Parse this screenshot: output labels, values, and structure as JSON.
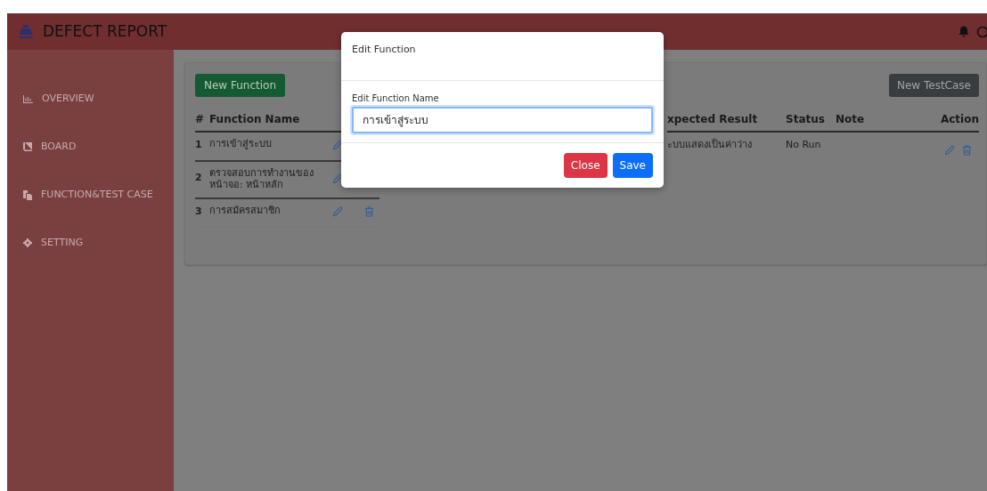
{
  "header": {
    "title": "DEFECT REPORT"
  },
  "sidebar": {
    "items": [
      {
        "label": "OVERVIEW"
      },
      {
        "label": "BOARD"
      },
      {
        "label": "FUNCTION&TEST CASE"
      },
      {
        "label": "SETTING"
      }
    ]
  },
  "functions": {
    "button": "New Function",
    "columns": [
      "#",
      "Function Name"
    ],
    "rows": [
      {
        "number": "1",
        "name": "การเข้าสู่ระบบ"
      },
      {
        "number": "2",
        "name": "ตรวจสอบการทำงานของหน้าจอ: หน้าหลัก"
      },
      {
        "number": "3",
        "name": "การสมัครสมาชิก"
      }
    ]
  },
  "testcases": {
    "button": "New TestCase",
    "columns": [
      "xpected Result",
      "Status",
      "Note",
      "Action"
    ],
    "rows": [
      {
        "expected_result": "ะบบแสดงเป็นค่าว่าง",
        "status": "No Run"
      }
    ]
  },
  "modal": {
    "title": "Edit Function",
    "field": {
      "label": "Edit Function Name",
      "value": "การเข้าสู่ระบบ"
    },
    "buttons": [
      {
        "label": "Close",
        "kind": "danger"
      },
      {
        "label": "Save",
        "kind": "primary"
      }
    ]
  }
}
